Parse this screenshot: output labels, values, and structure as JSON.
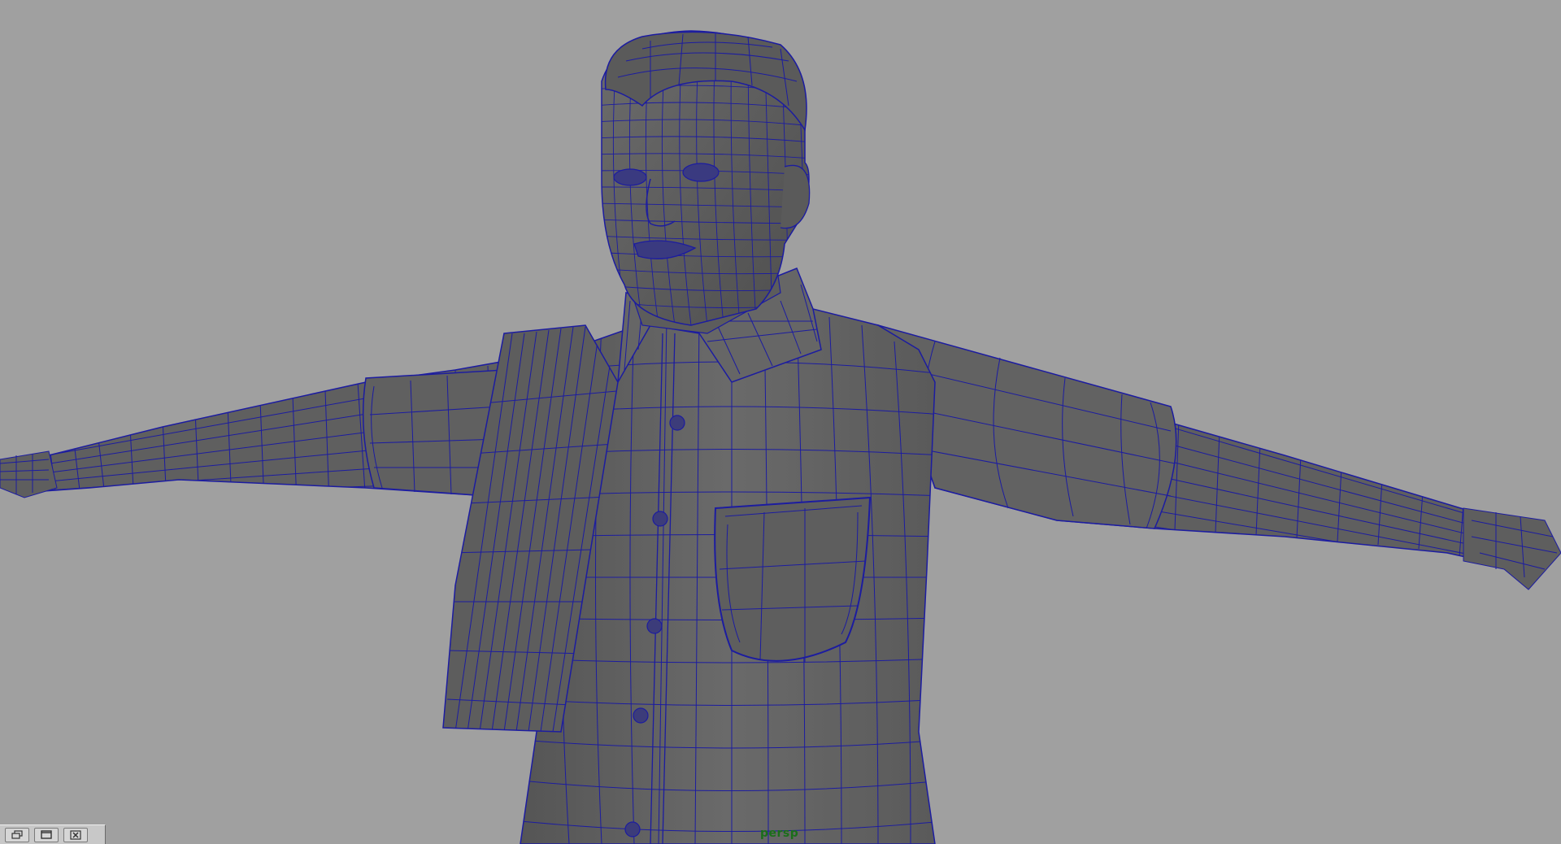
{
  "viewport": {
    "camera_name": "persp",
    "background_color": "#a0a0a0",
    "mesh_fill_color": "#5e5e5e",
    "wireframe_color": "#1c1ca0"
  },
  "panel_controls": [
    {
      "icon": "restore-panel-icon"
    },
    {
      "icon": "maximize-panel-icon"
    },
    {
      "icon": "close-panel-icon"
    }
  ]
}
